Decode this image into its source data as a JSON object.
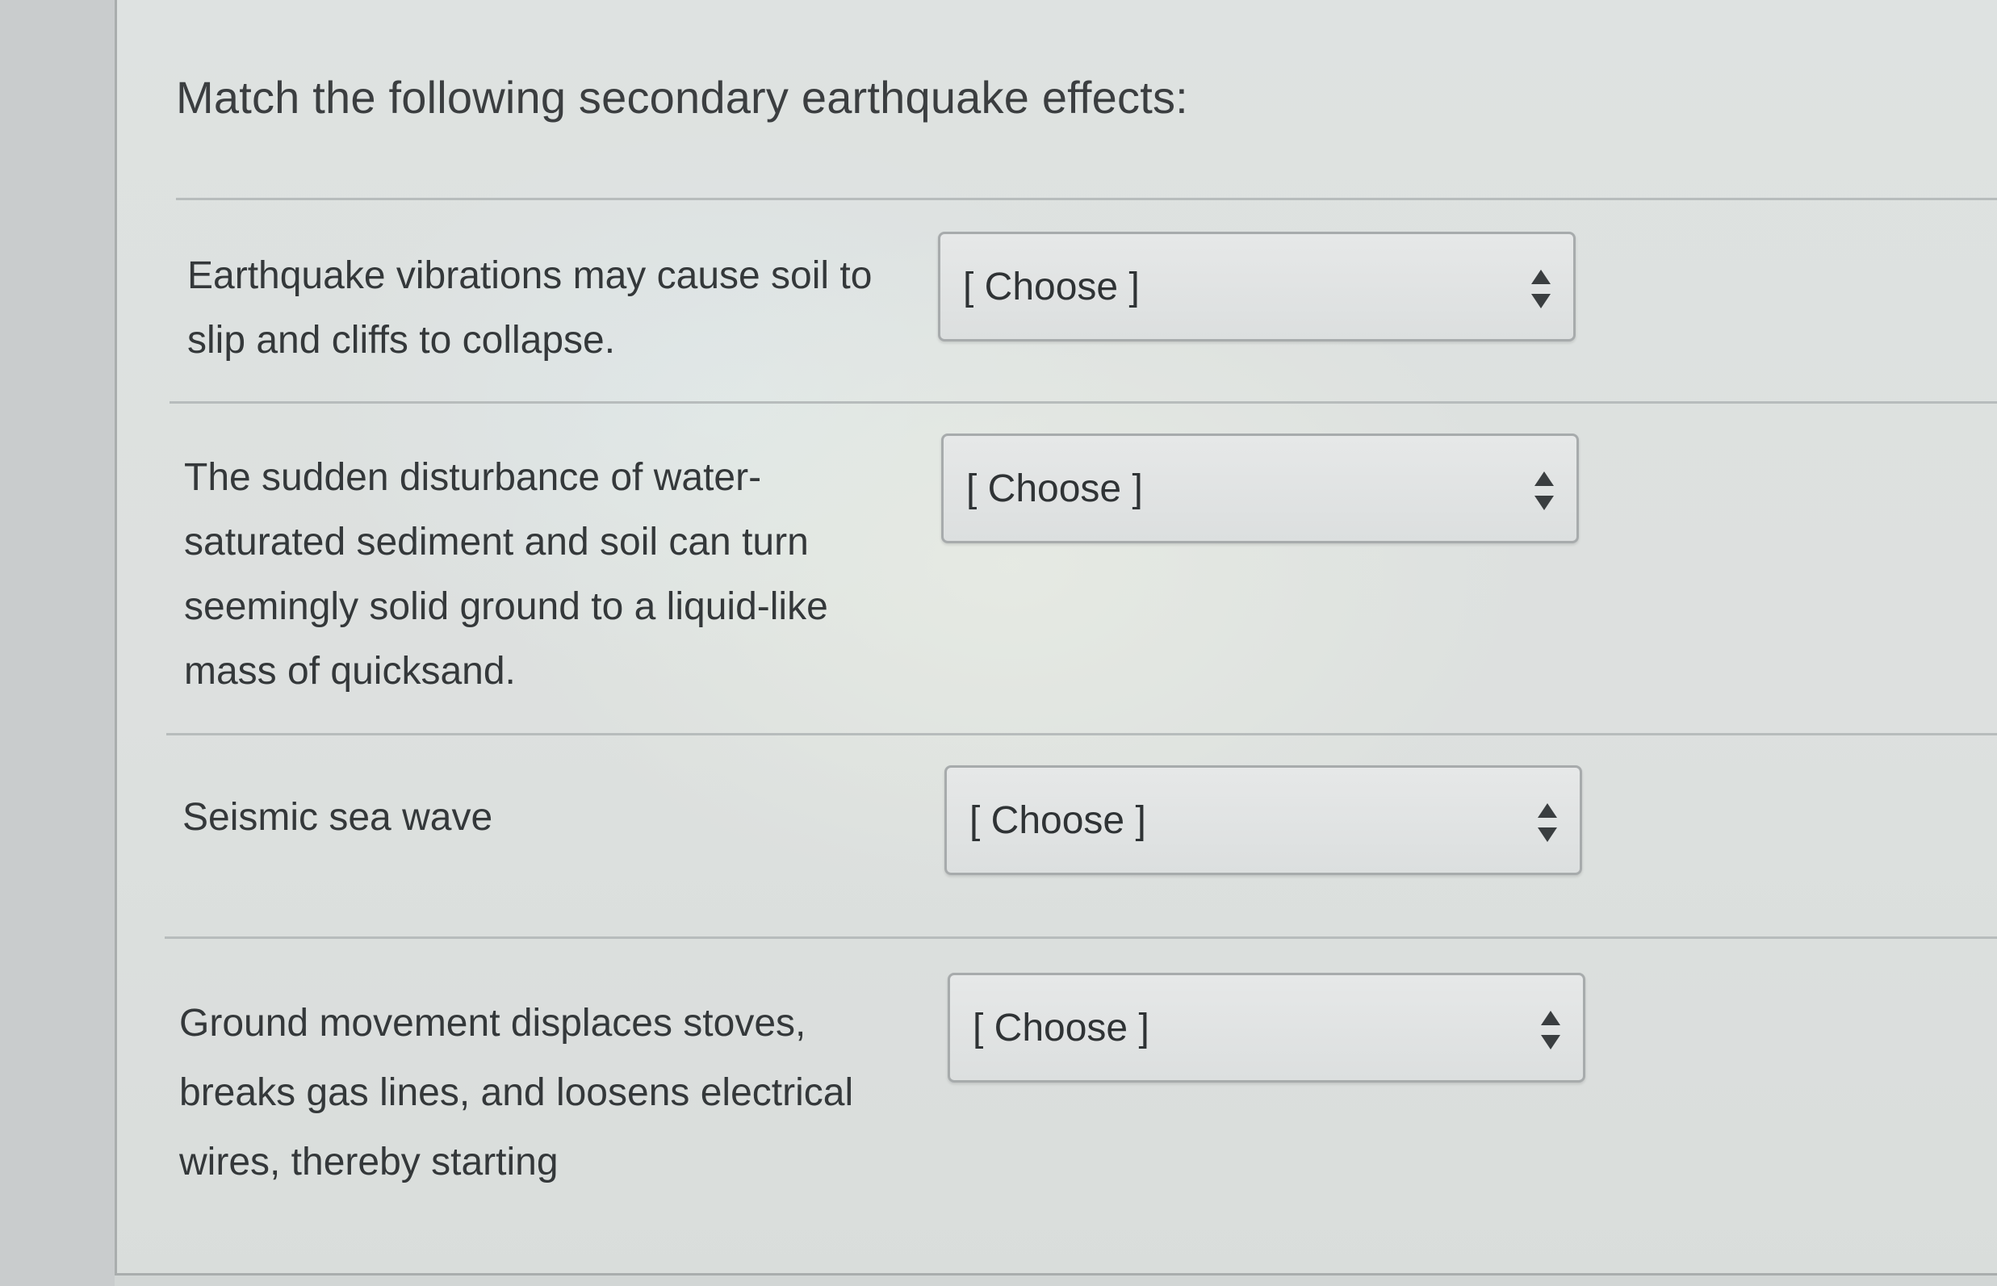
{
  "question": {
    "title": "Match the following secondary earthquake effects:"
  },
  "rows": [
    {
      "prompt": "Earthquake vibrations may cause soil to slip and cliffs to collapse.",
      "selected": "[ Choose ]"
    },
    {
      "prompt": "The sudden disturbance of water-saturated sediment and soil can turn seemingly solid ground to a liquid-like mass of quicksand.",
      "selected": "[ Choose ]"
    },
    {
      "prompt": "Seismic sea wave",
      "selected": "[ Choose ]"
    },
    {
      "prompt": "Ground movement displaces stoves, breaks gas lines, and loosens electrical wires, thereby starting",
      "selected": "[ Choose ]"
    }
  ],
  "icons": {
    "select_arrow": "up-down-arrows-icon"
  },
  "colors": {
    "text": "#34383a",
    "border": "#a7abac",
    "select_bg": "#e0e3e3"
  }
}
